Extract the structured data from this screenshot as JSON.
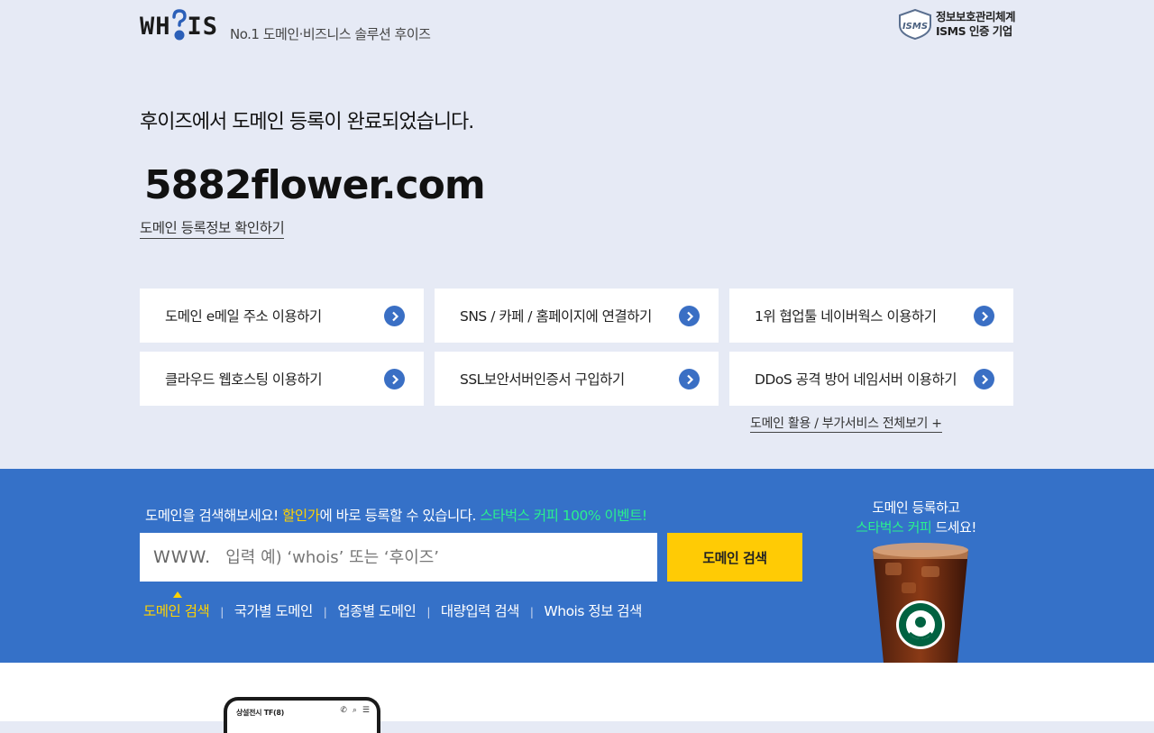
{
  "header": {
    "logo": "WHOIS",
    "slogan": "No.1 도메인·비즈니스 솔루션 후이즈",
    "isms_line1": "정보보호관리체계",
    "isms_line2": "ISMS 인증 기업"
  },
  "result": {
    "message": "후이즈에서 도메인 등록이 완료되었습니다.",
    "domain": "5882flower.com",
    "check_link": "도메인 등록정보 확인하기"
  },
  "services": [
    {
      "label": "도메인 e메일 주소 이용하기"
    },
    {
      "label": "SNS / 카페 / 홈페이지에 연결하기"
    },
    {
      "label": "1위 협업툴 네이버웍스 이용하기"
    },
    {
      "label": "클라우드 웹호스팅 이용하기"
    },
    {
      "label": "SSL보안서버인증서 구입하기"
    },
    {
      "label": "DDoS 공격 방어 네임서버 이용하기"
    }
  ],
  "all_services_link": "도메인 활용 / 부가서비스 전체보기 +",
  "search": {
    "promo_part1": "도메인을 검색해보세요! ",
    "promo_part2": "할인가",
    "promo_part3": "에 바로 등록할 수 있습니다. ",
    "promo_part4": "스타벅스 커피 100% 이벤트!",
    "prefix": "WWW.",
    "placeholder": "입력 예) ‘whois’ 또는 ‘후이즈’",
    "button": "도메인 검색",
    "tabs": [
      {
        "label": "도메인 검색",
        "active": true
      },
      {
        "label": "국가별 도메인"
      },
      {
        "label": "업종별 도메인"
      },
      {
        "label": "대량입력 검색"
      },
      {
        "label": "Whois 정보 검색"
      }
    ],
    "separator": "|"
  },
  "promo": {
    "line1": "도메인 등록하고",
    "line2_highlight": "스타벅스 커피",
    "line2_rest": " 드세요!"
  },
  "phone_preview": {
    "title": "상설전시 TF(8)"
  },
  "colors": {
    "top_background": "#e6eaf5",
    "search_band": "#3571c8",
    "accent_yellow": "#ffcb05",
    "accent_green": "#2af08e",
    "arrow_blue": "#3a6fc4"
  }
}
